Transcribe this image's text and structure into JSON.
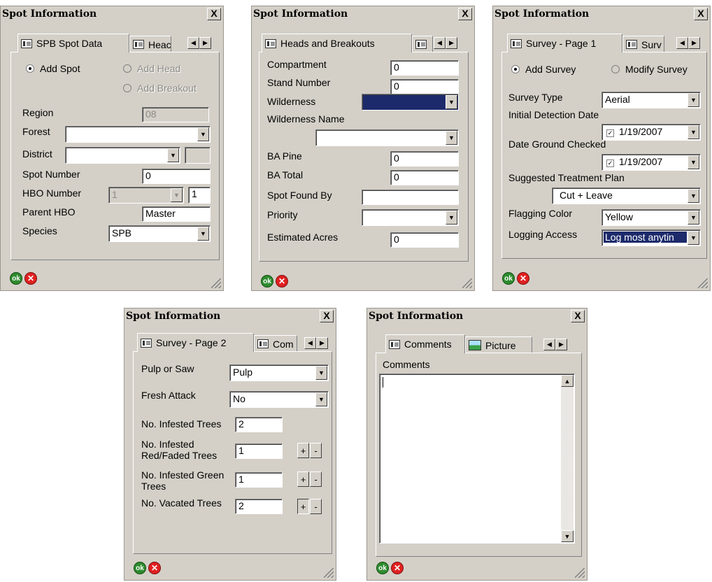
{
  "colors": {
    "dialog_bg": "#d4d0c8",
    "selection": "#1c2a6b",
    "ok_green": "#2e8b2e",
    "cancel_red": "#e02020"
  },
  "icons": {
    "close": "close-icon",
    "tab": "form-icon",
    "picture": "picture-icon",
    "ok": "ok-icon",
    "cancel": "cancel-icon"
  },
  "common": {
    "title": "Spot Information",
    "close": "X",
    "ok": "ok",
    "cancel": "✕",
    "left_arrow": "◀",
    "right_arrow": "▶",
    "dropdown": "▼"
  },
  "d1": {
    "tabs": [
      "SPB Spot Data",
      "Heac"
    ],
    "radios": [
      {
        "label": "Add Spot",
        "selected": true,
        "enabled": true
      },
      {
        "label": "Add Head",
        "selected": false,
        "enabled": false
      },
      {
        "label": "Add Breakout",
        "selected": false,
        "enabled": false
      }
    ],
    "region_label": "Region",
    "region_value": "08",
    "forest_label": "Forest",
    "forest_value": "",
    "district_label": "District",
    "district_value": "",
    "district_extra": "",
    "spot_number_label": "Spot Number",
    "spot_number_value": "0",
    "hbo_number_label": "HBO Number",
    "hbo_number_value": "1",
    "hbo_number_extra": "1",
    "parent_hbo_label": "Parent HBO",
    "parent_hbo_value": "Master",
    "species_label": "Species",
    "species_value": "SPB"
  },
  "d2": {
    "tabs": [
      "Heads and Breakouts"
    ],
    "compartment_label": "Compartment",
    "compartment_value": "0",
    "stand_number_label": "Stand Number",
    "stand_number_value": "0",
    "wilderness_label": "Wilderness",
    "wilderness_value": "",
    "wilderness_name_label": "Wilderness Name",
    "wilderness_name_value": "",
    "ba_pine_label": "BA Pine",
    "ba_pine_value": "0",
    "ba_total_label": "BA Total",
    "ba_total_value": "0",
    "spot_found_by_label": "Spot Found By",
    "spot_found_by_value": "",
    "priority_label": "Priority",
    "priority_value": "",
    "estimated_acres_label": "Estimated Acres",
    "estimated_acres_value": "0"
  },
  "d3": {
    "tabs": [
      "Survey - Page 1",
      "Surv"
    ],
    "radios": [
      {
        "label": "Add Survey",
        "selected": true
      },
      {
        "label": "Modify Survey",
        "selected": false
      }
    ],
    "survey_type_label": "Survey Type",
    "survey_type_value": "Aerial",
    "initial_detection_label": "Initial Detection Date",
    "initial_detection_value": "1/19/2007",
    "date_ground_label": "Date Ground Checked",
    "date_ground_value": "1/19/2007",
    "treatment_label": "Suggested Treatment Plan",
    "treatment_value": "Cut + Leave",
    "flagging_label": "Flagging Color",
    "flagging_value": "Yellow",
    "logging_label": "Logging Access",
    "logging_value": "Log most anytin",
    "check_mark": "✓"
  },
  "d4": {
    "tabs": [
      "Survey - Page 2",
      "Com"
    ],
    "pulp_label": "Pulp or Saw",
    "pulp_value": "Pulp",
    "fresh_label": "Fresh Attack",
    "fresh_value": "No",
    "infested_label": "No. Infested Trees",
    "infested_value": "2",
    "red_label_1": "No. Infested",
    "red_label_2": "Red/Faded Trees",
    "red_value": "1",
    "green_label_1": "No. Infested Green",
    "green_label_2": "Trees",
    "green_value": "1",
    "vacated_label": "No. Vacated Trees",
    "vacated_value": "2",
    "plus": "+",
    "minus": "-"
  },
  "d5": {
    "tabs": [
      "Comments",
      "Picture"
    ],
    "comments_label": "Comments",
    "comments_value": "",
    "scroll_up": "▲",
    "scroll_down": "▼"
  }
}
